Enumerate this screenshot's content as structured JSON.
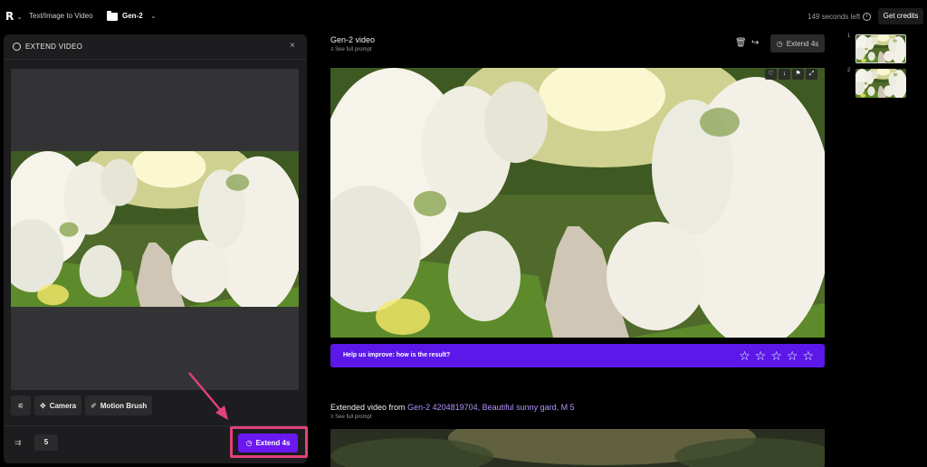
{
  "topbar": {
    "logo": "R",
    "breadcrumb": "Text/Image to Video",
    "project": "Gen-2",
    "seconds_left": "149 seconds left",
    "get_credits": "Get credits"
  },
  "panel": {
    "title": "EXTEND VIDEO",
    "close": "×",
    "tools": {
      "camera": "Camera",
      "motion_brush": "Motion Brush"
    },
    "duration": "5",
    "extend_button": "Extend 4s"
  },
  "main": {
    "video_title": "Gen-2 video",
    "see_full_prompt": "See full prompt",
    "extend_button": "Extend 4s",
    "feedback_text": "Help us improve: how is the result?",
    "rating_max": 5,
    "extended": {
      "prefix": "Extended video from ",
      "link": "Gen-2 4204819704, Beautiful sunny gard, M 5",
      "see_full_prompt": "See full prompt"
    }
  },
  "thumbs": {
    "first": "1",
    "second": "2"
  },
  "colors": {
    "accent": "#6b18f0",
    "feedback_bg": "#5b18e8",
    "highlight": "#e0427a",
    "link": "#b493ff"
  }
}
